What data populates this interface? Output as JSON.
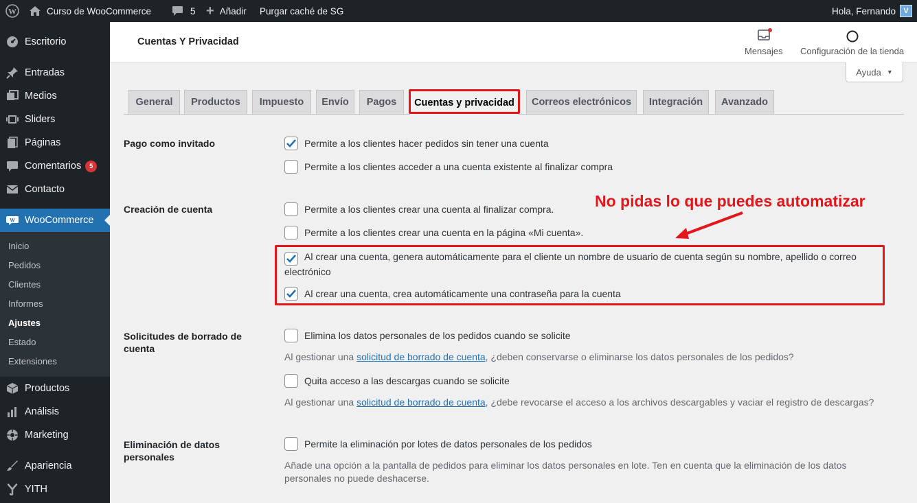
{
  "admin_bar": {
    "site_name": "Curso de WooCommerce",
    "comments_count": "5",
    "add_new": "Añadir",
    "purge_cache": "Purgar caché de SG",
    "greeting": "Hola, Fernando"
  },
  "sidebar": {
    "items": [
      {
        "label": "Escritorio",
        "icon": "dashboard-icon"
      },
      {
        "label": "Entradas",
        "icon": "pin-icon"
      },
      {
        "label": "Medios",
        "icon": "media-icon"
      },
      {
        "label": "Sliders",
        "icon": "slider-icon"
      },
      {
        "label": "Páginas",
        "icon": "page-icon"
      },
      {
        "label": "Comentarios",
        "icon": "comment-icon",
        "badge": "5"
      },
      {
        "label": "Contacto",
        "icon": "mail-icon"
      },
      {
        "label": "WooCommerce",
        "icon": "woo-icon"
      },
      {
        "label": "Productos",
        "icon": "box-icon"
      },
      {
        "label": "Análisis",
        "icon": "chart-icon"
      },
      {
        "label": "Marketing",
        "icon": "megaphone-icon"
      },
      {
        "label": "Apariencia",
        "icon": "brush-icon"
      },
      {
        "label": "YITH",
        "icon": "yith-icon"
      }
    ],
    "submenu": [
      "Inicio",
      "Pedidos",
      "Clientes",
      "Informes",
      "Ajustes",
      "Estado",
      "Extensiones"
    ]
  },
  "header": {
    "title": "Cuentas Y Privacidad",
    "messages": "Mensajes",
    "store_setup": "Configuración de la tienda",
    "help": "Ayuda"
  },
  "tabs": [
    "General",
    "Productos",
    "Impuesto",
    "Envío",
    "Pagos",
    "Cuentas y privacidad",
    "Correos electrónicos",
    "Integración",
    "Avanzado"
  ],
  "form": {
    "guest": {
      "heading": "Pago como invitado",
      "opt1": "Permite a los clientes hacer pedidos sin tener una cuenta",
      "opt2": "Permite a los clientes acceder a una cuenta existente al finalizar compra"
    },
    "account": {
      "heading": "Creación de cuenta",
      "opt1": "Permite a los clientes crear una cuenta al finalizar compra.",
      "opt2": "Permite a los clientes crear una cuenta en la página «Mi cuenta».",
      "opt3": "Al crear una cuenta, genera automáticamente para el cliente un nombre de usuario de cuenta según su nombre, apellido o correo electrónico",
      "opt4": "Al crear una cuenta, crea automáticamente una contraseña para la cuenta"
    },
    "erasure": {
      "heading": "Solicitudes de borrado de cuenta",
      "opt1": "Elimina los datos personales de los pedidos cuando se solicite",
      "desc1_pre": "Al gestionar una ",
      "desc1_link": "solicitud de borrado de cuenta",
      "desc1_post": ", ¿deben conservarse o eliminarse los datos personales de los pedidos?",
      "opt2": "Quita acceso a las descargas cuando se solicite",
      "desc2_pre": "Al gestionar una ",
      "desc2_link": "solicitud de borrado de cuenta",
      "desc2_post": ", ¿debe revocarse el acceso a los archivos descargables y vaciar el registro de descargas?"
    },
    "personal": {
      "heading": "Eliminación de datos personales",
      "opt1": "Permite la eliminación por lotes de datos personales de los pedidos",
      "desc": "Añade una opción a la pantalla de pedidos para eliminar los datos personales en lote. Ten en cuenta que la eliminación de los datos personales no puede deshacerse."
    }
  },
  "annotation": "No pidas lo que puedes automatizar",
  "colors": {
    "accent": "#2271b1",
    "annotation": "#e3161b",
    "adminbar": "#1d2327"
  }
}
